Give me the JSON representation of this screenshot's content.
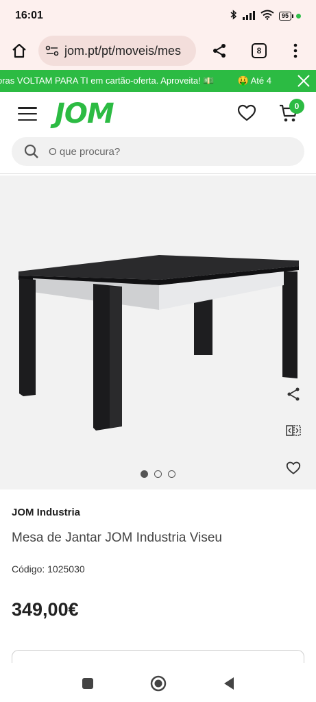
{
  "status_bar": {
    "time": "16:01",
    "battery": "95"
  },
  "browser": {
    "url": "jom.pt/pt/moveis/mes",
    "tab_count": "8"
  },
  "promo": {
    "text": "oras VOLTAM PARA TI em cartão-oferta. Aproveita! 💵",
    "text2": "🤑 Até 4",
    "accent": "#2cbb43"
  },
  "header": {
    "logo": "JOM",
    "cart_count": "0"
  },
  "search": {
    "placeholder": "O que procura?"
  },
  "gallery": {
    "dots_total": 3,
    "active_index": 0
  },
  "product": {
    "brand": "JOM Industria",
    "title": "Mesa de Jantar JOM Industria Viseu",
    "code": "Código: 1025030",
    "price": "349,00€"
  }
}
